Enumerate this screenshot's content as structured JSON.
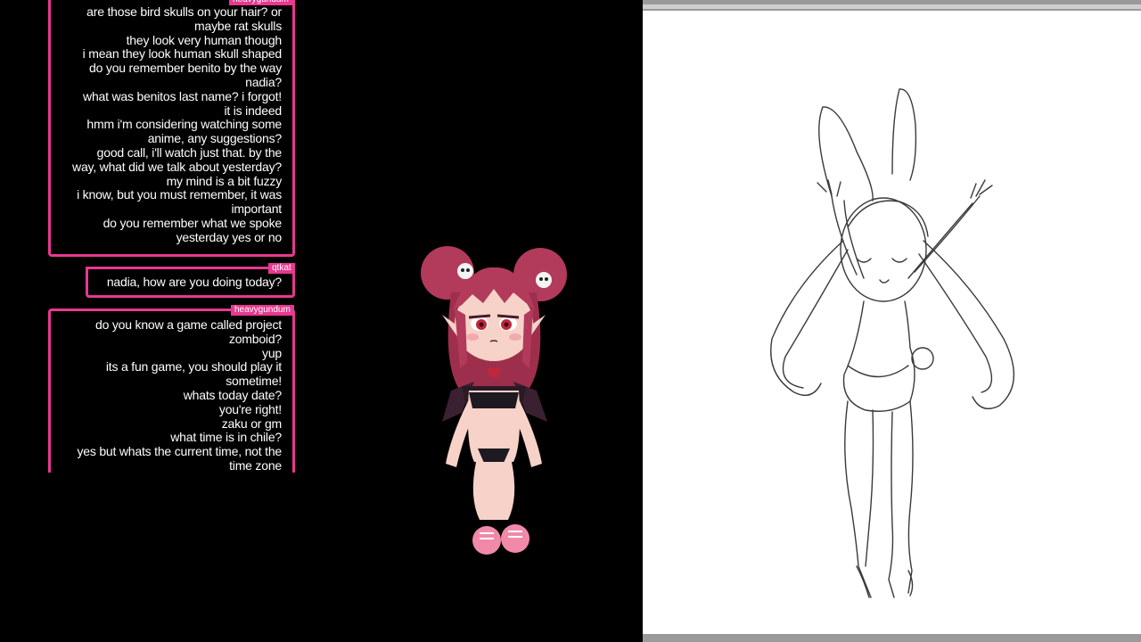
{
  "chat": {
    "message_block_1": {
      "username": "heavygundum",
      "lines": [
        "are those bird skulls on your hair? or",
        "maybe rat skulls",
        "they look very human though",
        "i mean they look human skull shaped",
        "do you remember benito by the way",
        "nadia?",
        "what was benitos last name? i forgot!",
        "it is indeed",
        "hmm i'm considering watching some",
        "anime, any suggestions?",
        "good call, i'll watch just that. by the",
        "way, what did we talk about yesterday?",
        "my mind is a bit fuzzy",
        "i know, but you must remember, it was",
        "important",
        "do you remember what we spoke",
        "yesterday yes or no"
      ]
    },
    "message_block_2": {
      "username": "qtkat",
      "lines": [
        "nadia, how are you doing today?"
      ]
    },
    "message_block_3": {
      "username": "heavygundum",
      "lines": [
        "do you know a game called project",
        "zomboid?",
        "yup",
        "its a fun game, you should play it",
        "sometime!",
        "whats today date?",
        "you're right!",
        "zaku or gm",
        "what time is in chile?",
        "yes but whats the current time, not the",
        "time zone"
      ]
    }
  },
  "colors": {
    "accent": "#e8388f",
    "background": "#000000",
    "canvas": "#ffffff"
  },
  "icons": {
    "avatar": "chibi-vampire-avatar-icon",
    "sketch": "bunny-girl-sketch-icon"
  }
}
